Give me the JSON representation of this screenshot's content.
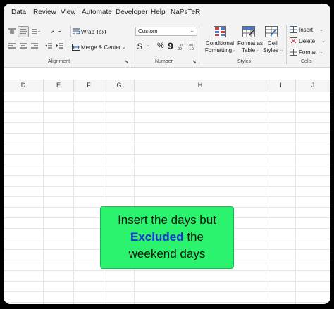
{
  "menu": [
    "Data",
    "Review",
    "View",
    "Automate",
    "Developer",
    "Help",
    "NaPsTeR"
  ],
  "ribbon": {
    "alignment": {
      "wrap_text": "Wrap Text",
      "merge_center": "Merge & Center",
      "group_label": "Alignment"
    },
    "number": {
      "format_value": "Custom",
      "currency": "$",
      "percent": "%",
      "comma": "9",
      "group_label": "Number"
    },
    "styles": {
      "conditional_line1": "Conditional",
      "conditional_line2": "Formatting",
      "format_table_line1": "Format as",
      "format_table_line2": "Table",
      "cell_styles_line1": "Cell",
      "cell_styles_line2": "Styles",
      "group_label": "Styles"
    },
    "cells": {
      "insert": "Insert",
      "delete": "Delete",
      "format": "Format",
      "group_label": "Cells"
    }
  },
  "columns": [
    "D",
    "E",
    "F",
    "G",
    "H",
    "I",
    "J"
  ],
  "callout": {
    "line1": "Insert the days but",
    "emphasis": "Excluded",
    "line2_rest": " the",
    "line3": "weekend days"
  },
  "colors": {
    "callout_bg": "#2bf36e",
    "callout_emphasis": "#1a2fd6"
  }
}
